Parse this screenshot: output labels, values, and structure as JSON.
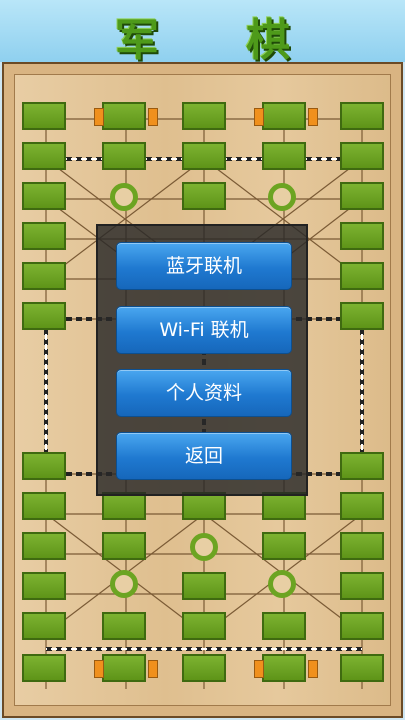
{
  "header": {
    "title": "军 棋"
  },
  "menu": {
    "items": [
      {
        "label": "蓝牙联机"
      },
      {
        "label": "Wi-Fi 联机"
      },
      {
        "label": "个人资料"
      },
      {
        "label": "返回"
      }
    ]
  },
  "colors": {
    "piece_green": "#6ca422",
    "menu_blue": "#1f79d0",
    "board_wood": "#e0c290",
    "hq_orange": "#f0901d"
  },
  "icons": {
    "camp": "camp-circle-icon",
    "headquarters": "hq-marker-icon"
  }
}
